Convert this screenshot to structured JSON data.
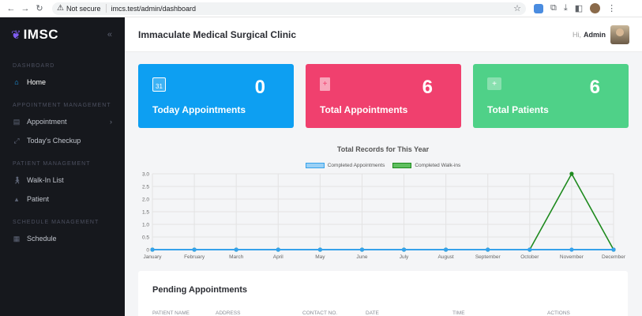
{
  "browser": {
    "security_label": "Not secure",
    "url": "imcs.test/admin/dashboard"
  },
  "sidebar": {
    "brand": "IMSC",
    "sections": {
      "dashboard": "DASHBOARD",
      "appointment": "APPOINTMENT MANAGEMENT",
      "patient": "PATIENT MANAGEMENT",
      "schedule": "SCHEDULE MANAGEMENT"
    },
    "items": {
      "home": "Home",
      "appointment": "Appointment",
      "checkup": "Today's Checkup",
      "walkin": "Walk-In List",
      "patient": "Patient",
      "schedule": "Schedule"
    }
  },
  "header": {
    "title": "Immaculate Medical Surgical Clinic",
    "greeting": "Hi,",
    "user": "Admin"
  },
  "cards": [
    {
      "label": "Today Appointments",
      "value": "0",
      "color": "#0d9ff2",
      "icon": "calendar-icon"
    },
    {
      "label": "Total Appointments",
      "value": "6",
      "color": "#f0406e",
      "icon": "document-icon"
    },
    {
      "label": "Total Patients",
      "value": "6",
      "color": "#4fd188",
      "icon": "medkit-icon"
    }
  ],
  "chart_data": {
    "type": "line",
    "title": "Total Records for This Year",
    "categories": [
      "January",
      "February",
      "March",
      "April",
      "May",
      "June",
      "July",
      "August",
      "September",
      "October",
      "November",
      "December"
    ],
    "series": [
      {
        "name": "Completed Appointments",
        "color": "#36a2eb",
        "values": [
          0,
          0,
          0,
          0,
          0,
          0,
          0,
          0,
          0,
          0,
          0,
          0
        ]
      },
      {
        "name": "Completed Walk-ins",
        "color": "#1e8a1e",
        "values": [
          0,
          0,
          0,
          0,
          0,
          0,
          0,
          0,
          0,
          0,
          3,
          0
        ]
      }
    ],
    "ylim": [
      0,
      3.0
    ],
    "yticks": [
      "3.0",
      "2.5",
      "2.0",
      "1.5",
      "1.0",
      "0.5",
      "0"
    ],
    "legend": "top",
    "grid": true
  },
  "pending": {
    "title": "Pending Appointments",
    "columns": [
      "PATIENT NAME",
      "ADDRESS",
      "CONTACT NO.",
      "DATE",
      "TIME",
      "ACTIONS"
    ]
  }
}
